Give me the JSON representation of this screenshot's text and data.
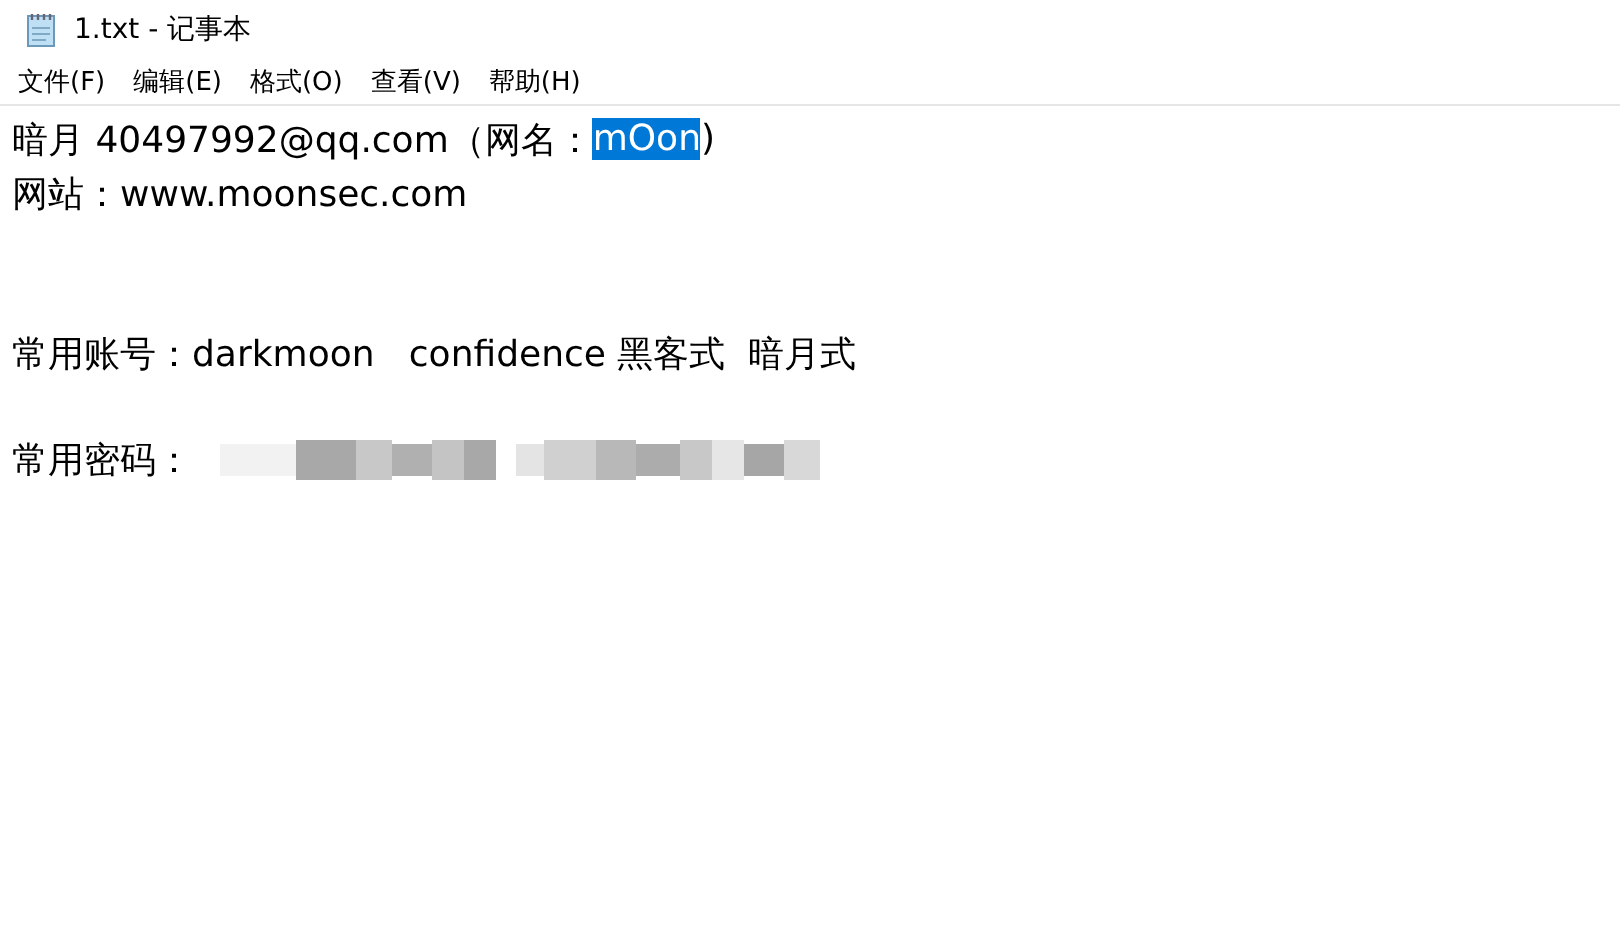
{
  "window": {
    "title": "1.txt - 记事本"
  },
  "menu": [
    "文件(F)",
    "编辑(E)",
    "格式(O)",
    "查看(V)",
    "帮助(H)"
  ],
  "lines": [
    {
      "segments": [
        {
          "kind": "text",
          "text": "暗月 40497992@qq.com（网名：",
          "selected": false
        },
        {
          "kind": "text",
          "text": "mOon",
          "selected": true
        },
        {
          "kind": "text",
          "text": ")",
          "selected": false
        }
      ]
    },
    {
      "segments": [
        {
          "kind": "text",
          "text": "网站：www.moonsec.com",
          "selected": false
        }
      ]
    },
    {
      "kind": "blank"
    },
    {
      "kind": "blank"
    },
    {
      "segments": [
        {
          "kind": "text",
          "text": "常用账号：darkmoon   confidence 黑客式  暗月式",
          "selected": false
        }
      ]
    },
    {
      "kind": "blank"
    },
    {
      "segments": [
        {
          "kind": "text",
          "text": "常用密码：",
          "selected": false
        },
        {
          "kind": "redacted"
        }
      ]
    }
  ]
}
